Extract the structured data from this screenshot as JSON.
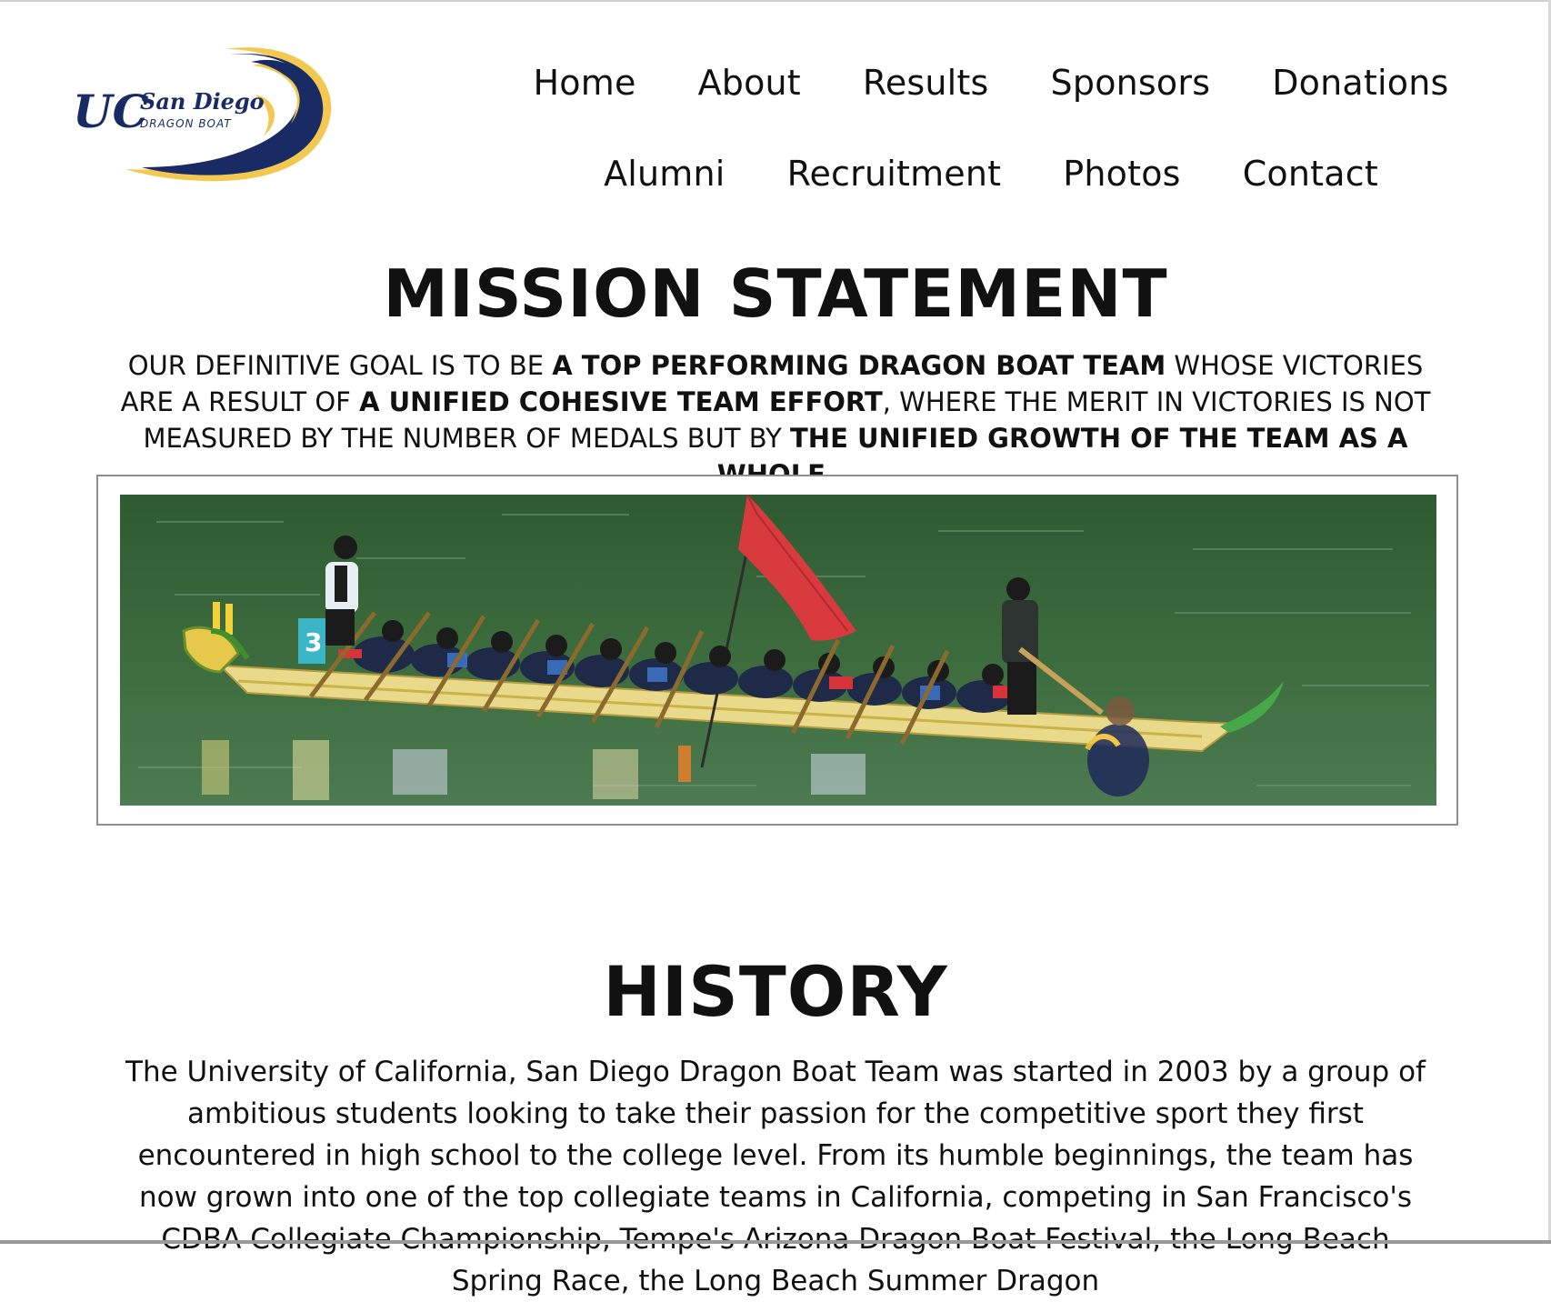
{
  "brand": {
    "logo_text_primary": "UC",
    "logo_text_secondary": "San Diego",
    "logo_text_tertiary": "DRAGON BOAT",
    "colors": {
      "navy": "#182b65",
      "gold": "#f3c851"
    }
  },
  "nav": {
    "row1": [
      "Home",
      "About",
      "Results",
      "Sponsors",
      "Donations"
    ],
    "row2": [
      "Alumni",
      "Recruitment",
      "Photos",
      "Contact"
    ]
  },
  "mission": {
    "title": "MISSION STATEMENT",
    "p1": "OUR DEFINITIVE GOAL IS TO BE ",
    "b1": "A TOP PERFORMING DRAGON BOAT TEAM",
    "p2": " WHOSE VICTORIES ARE A RESULT OF ",
    "b2": "A UNIFIED COHESIVE TEAM EFFORT",
    "p3": ", WHERE THE MERIT IN VICTORIES IS NOT MEASURED BY THE NUMBER OF MEDALS BUT BY ",
    "b3": "THE UNIFIED GROWTH OF THE TEAM AS A WHOLE",
    "p4": "."
  },
  "history": {
    "title": "HISTORY",
    "text": "The University of California, San Diego Dragon Boat Team was started in 2003 by a group of ambitious students looking to take their passion for the competitive sport they first encountered in high school to the college level. From its humble beginnings, the team has now grown into one of the top collegiate teams in California, competing in San Francisco's CDBA Collegiate Championship, Tempe's Arizona Dragon Boat Festival, the Long Beach Spring Race, the Long Beach Summer Dragon"
  },
  "photo": {
    "boat_number": "3"
  }
}
